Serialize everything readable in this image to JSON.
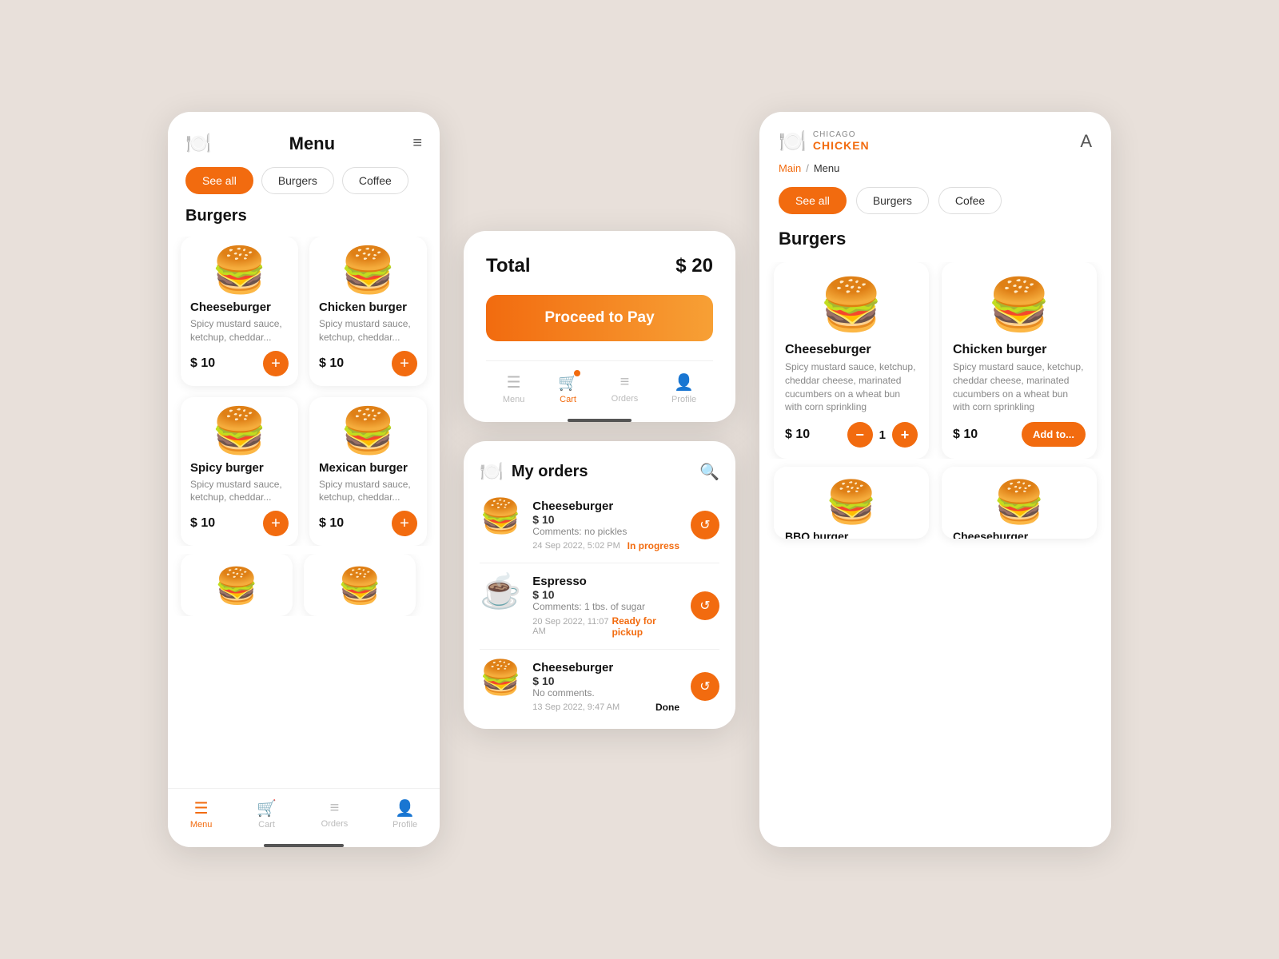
{
  "left": {
    "title": "Menu",
    "filters": [
      {
        "label": "See all",
        "active": true
      },
      {
        "label": "Burgers",
        "active": false
      },
      {
        "label": "Coffee",
        "active": false
      }
    ],
    "section": "Burgers",
    "items": [
      {
        "name": "Cheeseburger",
        "desc": "Spicy mustard sauce, ketchup, cheddar...",
        "price": "$ 10",
        "emoji": "🍔"
      },
      {
        "name": "Chicken burger",
        "desc": "Spicy mustard sauce, ketchup, cheddar...",
        "price": "$ 10",
        "emoji": "🍔"
      },
      {
        "name": "Spicy burger",
        "desc": "Spicy mustard sauce, ketchup, cheddar...",
        "price": "$ 10",
        "emoji": "🍔"
      },
      {
        "name": "Mexican burger",
        "desc": "Spicy mustard sauce, ketchup, cheddar...",
        "price": "$ 10",
        "emoji": "🍔"
      }
    ],
    "nav": [
      {
        "label": "Menu",
        "active": true,
        "icon": "☰"
      },
      {
        "label": "Cart",
        "active": false,
        "icon": "🛒"
      },
      {
        "label": "Orders",
        "active": false,
        "icon": "≡"
      },
      {
        "label": "Profile",
        "active": false,
        "icon": "👤"
      }
    ]
  },
  "cart": {
    "total_label": "Total",
    "total_value": "$ 20",
    "proceed_label": "Proceed to Pay",
    "nav": [
      {
        "label": "Menu",
        "active": false,
        "icon": "☰"
      },
      {
        "label": "Cart",
        "active": true,
        "icon": "🛒"
      },
      {
        "label": "Orders",
        "active": false,
        "icon": "≡"
      },
      {
        "label": "Profile",
        "active": false,
        "icon": "👤"
      }
    ]
  },
  "orders": {
    "title": "My orders",
    "items": [
      {
        "name": "Cheeseburger",
        "price": "$ 10",
        "comment": "Comments: no pickles",
        "date": "24 Sep 2022, 5:02 PM",
        "status": "In progress",
        "status_type": "progress",
        "emoji": "🍔"
      },
      {
        "name": "Espresso",
        "price": "$ 10",
        "comment": "Comments: 1 tbs. of sugar",
        "date": "20 Sep 2022, 11:07 AM",
        "status": "Ready for pickup",
        "status_type": "pickup",
        "emoji": "☕"
      },
      {
        "name": "Cheeseburger",
        "price": "$ 10",
        "comment": "No comments.",
        "date": "13 Sep 2022, 9:47 AM",
        "status": "Done",
        "status_type": "done",
        "emoji": "🍔"
      }
    ]
  },
  "right": {
    "logo_chicago": "CHICAGO",
    "logo_chicken": "CHICKEN",
    "breadcrumb_main": "Main",
    "breadcrumb_sep": "/",
    "breadcrumb_current": "Menu",
    "filters": [
      {
        "label": "See all",
        "active": true
      },
      {
        "label": "Burgers",
        "active": false
      },
      {
        "label": "Cofee",
        "active": false
      }
    ],
    "section": "Burgers",
    "items": [
      {
        "name": "Cheeseburger",
        "desc": "Spicy mustard sauce, ketchup, cheddar cheese, marinated cucumbers on a wheat bun with corn sprinkling",
        "price": "$ 10",
        "emoji": "🍔",
        "qty": "1",
        "has_qty": true
      },
      {
        "name": "Chicken burger",
        "desc": "Spicy mustard sauce, ketchup, cheddar cheese, marinated cucumbers on a wheat bun with corn sprinkling",
        "price": "$ 10",
        "emoji": "🍔",
        "has_qty": false,
        "add_label": "Add to..."
      }
    ],
    "partial_items": [
      {
        "name": "BBQ burger",
        "emoji": "🍔"
      },
      {
        "name": "Cheeseburger",
        "emoji": "🍔"
      }
    ]
  }
}
